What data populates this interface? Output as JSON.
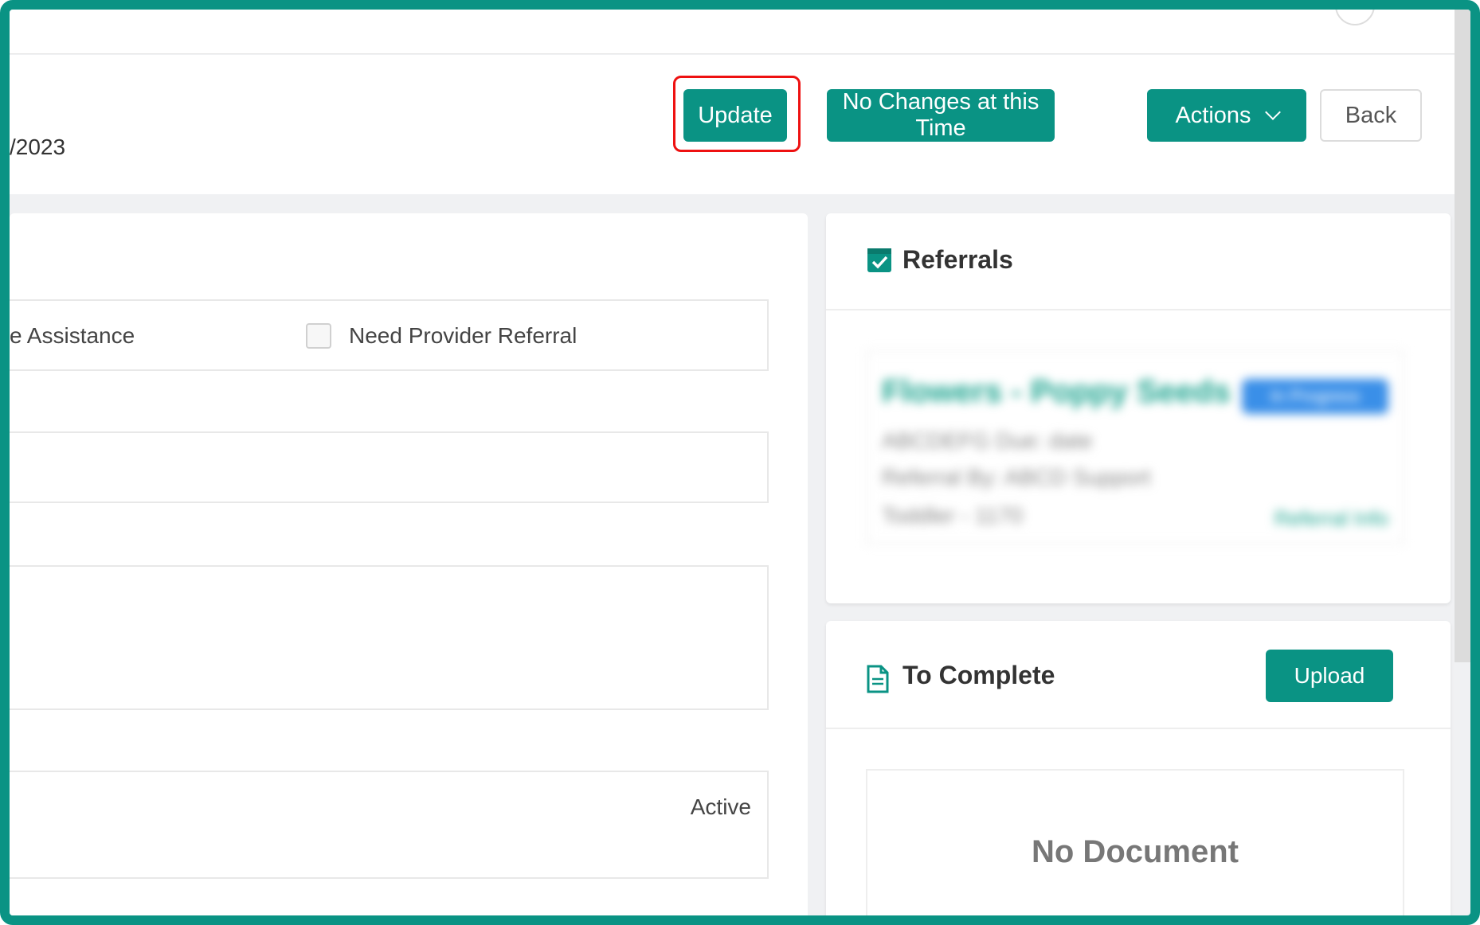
{
  "header": {
    "date_fragment": "/2023",
    "buttons": {
      "update": "Update",
      "no_changes": "No Changes at this Time",
      "actions": "Actions",
      "back": "Back"
    }
  },
  "form": {
    "assistance_label": "e Assistance",
    "need_provider_referral_label": "Need Provider Referral",
    "need_provider_referral_checked": false,
    "status_value": "Active"
  },
  "referrals": {
    "title": "Referrals",
    "item": {
      "name": "Flowers - Poppy Seeds",
      "badge": "In Progress",
      "line1": "ABCDEFG Due: date",
      "line2": "Referral By: ABCD Support",
      "line3": "Toddler - 1170",
      "link": "Referral Info"
    }
  },
  "to_complete": {
    "title": "To Complete",
    "upload_label": "Upload",
    "empty_text": "No Document"
  },
  "colors": {
    "accent": "#0a9384",
    "highlight": "#ee1111"
  }
}
